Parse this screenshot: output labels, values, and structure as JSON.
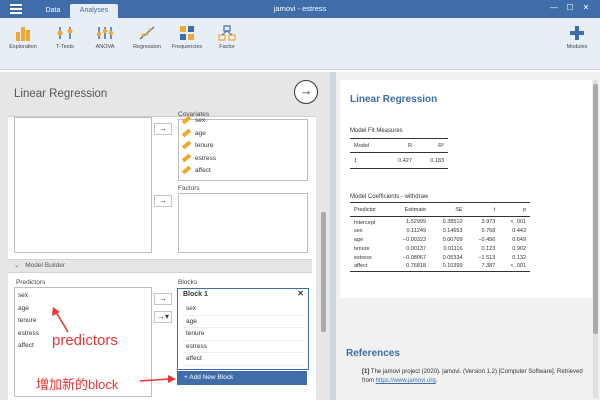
{
  "window": {
    "title": "jamovi - estress",
    "tabs": [
      "Data",
      "Analyses"
    ],
    "controls": [
      "—",
      "☐",
      "✕"
    ]
  },
  "ribbon": {
    "buttons": [
      "Exploration",
      "T-Tests",
      "ANOVA",
      "Regression",
      "Frequencies",
      "Factor"
    ],
    "modules": "Modules"
  },
  "analysis": {
    "title": "Linear Regression",
    "covariates_label": "Covariates",
    "covariates": [
      "sex",
      "age",
      "tenure",
      "estress",
      "affect"
    ],
    "factors_label": "Factors",
    "model_builder_label": "Model Builder",
    "predictors_label": "Predictors",
    "predictors": [
      "sex",
      "age",
      "tenure",
      "estress",
      "affect"
    ],
    "blocks_label": "Blocks",
    "block_title": "Block 1",
    "block_items": [
      "sex",
      "age",
      "tenure",
      "estress",
      "affect"
    ],
    "add_block_label": "+ Add New Block"
  },
  "annotations": {
    "predictors": "predictors",
    "add_block": "增加新的block"
  },
  "results": {
    "title": "Linear Regression",
    "fit_title": "Model Fit Measures",
    "fit_headers": [
      "Model",
      "R",
      "R²"
    ],
    "fit_rows": [
      [
        "1",
        "0.427",
        "0.183"
      ]
    ],
    "coef_title": "Model Coefficients - withdraw",
    "coef_headers": [
      "Predictor",
      "Estimate",
      "SE",
      "t",
      "p"
    ],
    "coef_rows": [
      [
        "Intercept",
        "1.52999",
        "0.38510",
        "3.973",
        "< .001"
      ],
      [
        "sex",
        "0.11249",
        "0.14653",
        "0.768",
        "0.443"
      ],
      [
        "age",
        "−0.00323",
        "0.00709",
        "−0.456",
        "0.649"
      ],
      [
        "tenure",
        "0.00137",
        "0.01116",
        "0.123",
        "0.902"
      ],
      [
        "estress",
        "−0.08067",
        "0.05334",
        "−1.513",
        "0.132"
      ],
      [
        "affect",
        "0.76818",
        "0.10399",
        "7.387",
        "< .001"
      ]
    ],
    "references_title": "References",
    "ref_num": "[1]",
    "ref_text": "The jamovi project (2020). jamovi. (Version 1.2) [Computer Software]. Retrieved from",
    "ref_link": "https://www.jamovi.org",
    "ref_end": "."
  },
  "colors": {
    "accent": "#3e6da9",
    "annotation": "#ee3333",
    "ruler_icon": "#f0a830"
  }
}
